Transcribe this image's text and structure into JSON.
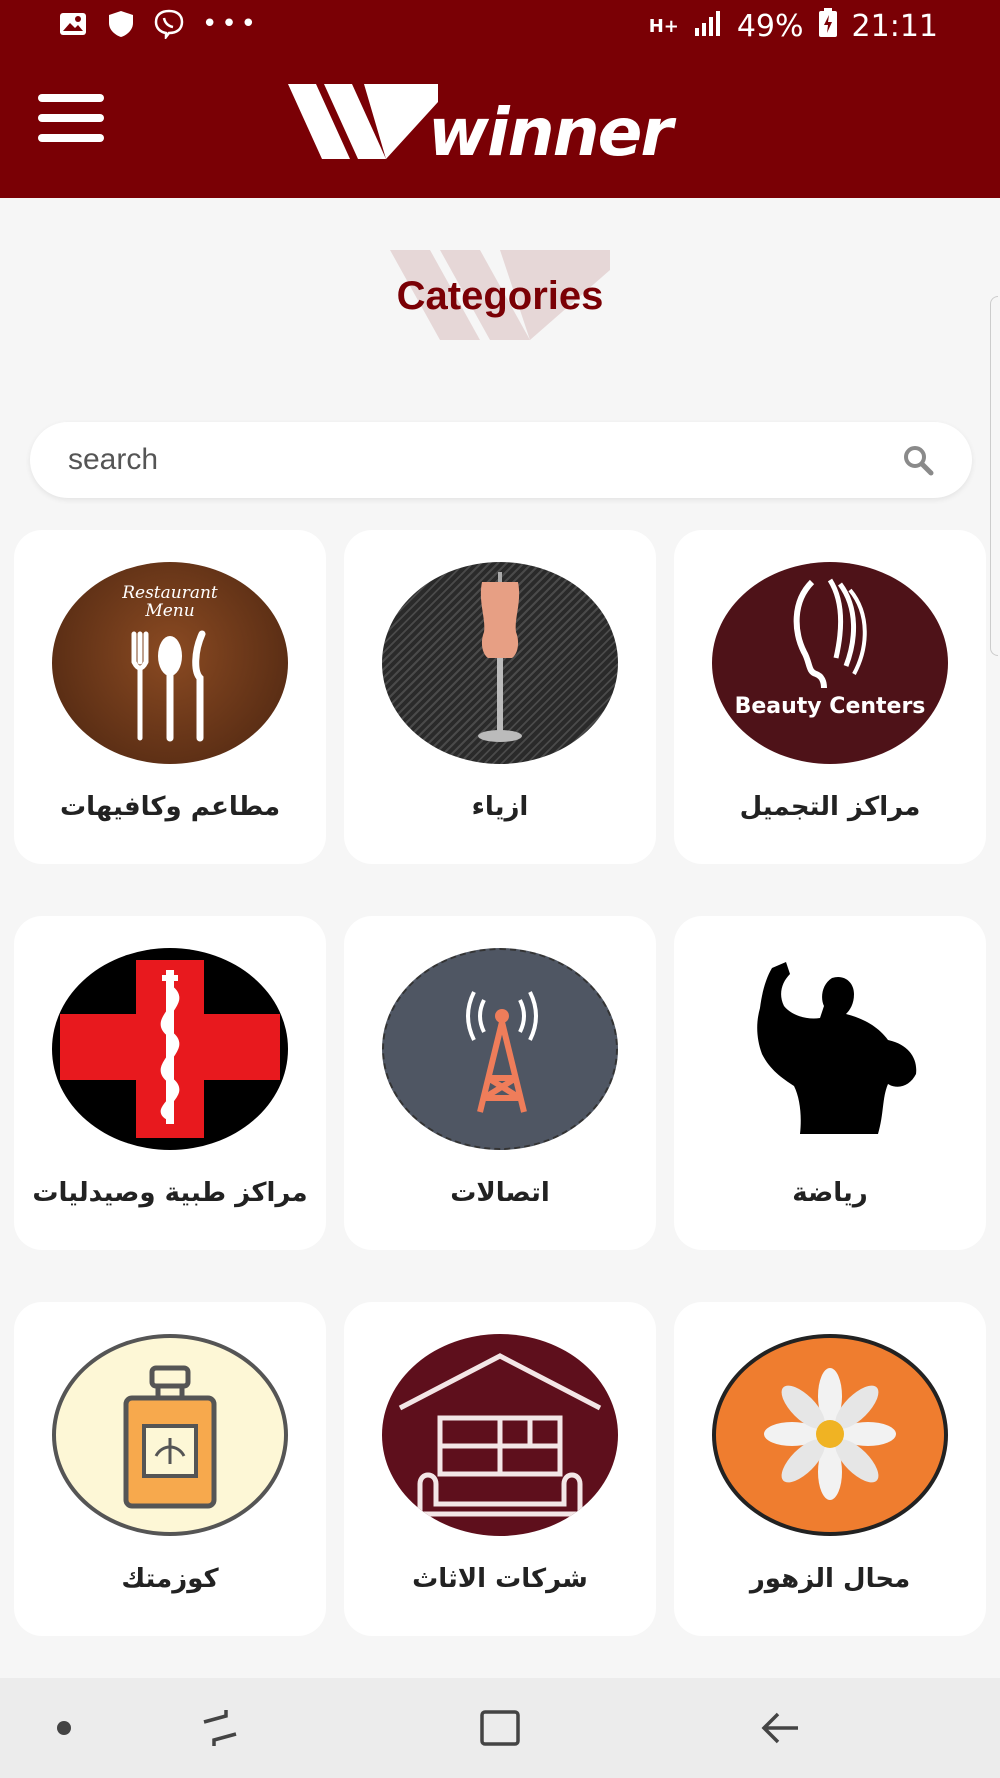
{
  "status_bar": {
    "battery": "49%",
    "time": "21:11",
    "network": "H+",
    "overflow": "•••",
    "icons": [
      "image-icon",
      "shield-icon",
      "viber-icon",
      "network-icon",
      "signal-icon",
      "battery-icon"
    ]
  },
  "app_bar": {
    "logo_text": "winner",
    "menu_icon": "hamburger-menu-icon"
  },
  "page": {
    "title": "Categories"
  },
  "search": {
    "placeholder": "search",
    "value": "",
    "icon": "search-icon"
  },
  "categories": [
    {
      "label": "مراكز التجميل",
      "icon": "beauty-icon",
      "badge_text": "Beauty Centers",
      "color": "#4e1218"
    },
    {
      "label": "ازياء",
      "icon": "mannequin-icon",
      "color": "#2d2d2d"
    },
    {
      "label": "مطاعم وكافيهات",
      "icon": "restaurant-menu-icon",
      "badge_text": "Restaurant Menu",
      "color": "#6b3a1f"
    },
    {
      "label": "رياضة",
      "icon": "bodybuilder-icon",
      "color": "#ffffff"
    },
    {
      "label": "اتصالات",
      "icon": "antenna-tower-icon",
      "color": "#4f5663"
    },
    {
      "label": "مراكز طبية وصيدليات",
      "icon": "medical-cross-icon",
      "color": "#000000"
    },
    {
      "label": "محال الزهور",
      "icon": "flower-icon",
      "color": "#ef7d2f"
    },
    {
      "label": "شركات الاثاث",
      "icon": "furniture-house-icon",
      "color": "#5e0f1c"
    },
    {
      "label": "كوزمتك",
      "icon": "perfume-bottle-icon",
      "color": "#fdf7d6"
    }
  ],
  "colors": {
    "brand": "#7a0005",
    "background": "#f6f6f6",
    "card": "#ffffff"
  },
  "nav_bar": {
    "items": [
      "dot-icon",
      "recent-apps-icon",
      "home-icon",
      "back-icon"
    ]
  }
}
